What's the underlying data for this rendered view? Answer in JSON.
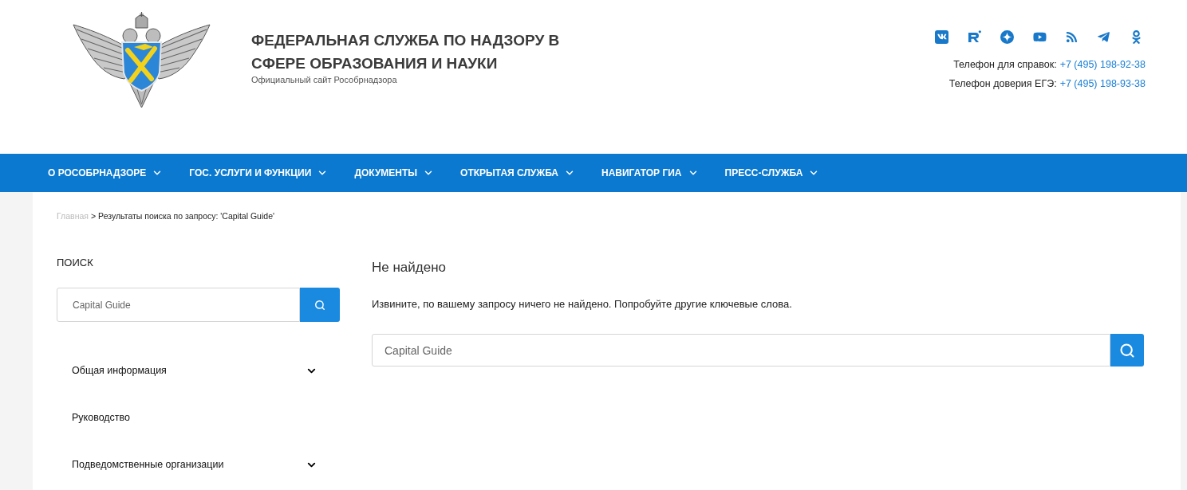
{
  "header": {
    "title": "ФЕДЕРАЛЬНАЯ СЛУЖБА ПО НАДЗОРУ В СФЕРЕ ОБРАЗОВАНИЯ И НАУКИ",
    "subtitle": "Официальный сайт Рособрнадзора",
    "social_links": [
      {
        "kind": "vk"
      },
      {
        "kind": "rutube"
      },
      {
        "kind": "dzen"
      },
      {
        "kind": "youtube"
      },
      {
        "kind": "rss"
      },
      {
        "kind": "telegram"
      },
      {
        "kind": "ok"
      }
    ],
    "contacts": [
      {
        "label": "Телефон для справок:",
        "phone": "+7 (495) 198-92-38"
      },
      {
        "label": "Телефон доверия ЕГЭ:",
        "phone": "+7 (495) 198-93-38"
      }
    ]
  },
  "nav": [
    {
      "label": "О РОСОБРНАДЗОРЕ",
      "has_dropdown": true
    },
    {
      "label": "ГОС. УСЛУГИ И ФУНКЦИИ",
      "has_dropdown": true
    },
    {
      "label": "ДОКУМЕНТЫ",
      "has_dropdown": true
    },
    {
      "label": "ОТКРЫТАЯ СЛУЖБА",
      "has_dropdown": true
    },
    {
      "label": "НАВИГАТОР ГИА",
      "has_dropdown": true
    },
    {
      "label": "ПРЕСС-СЛУЖБА",
      "has_dropdown": true
    }
  ],
  "breadcrumb": {
    "links": [
      "Главная"
    ],
    "separator": ">",
    "current": "Результаты поиска по запросу: 'Capital Guide'"
  },
  "sidebar": {
    "heading": "ПОИСК",
    "search": {
      "value": "Capital Guide"
    },
    "menu": [
      {
        "label": "Общая информация",
        "expandable": true
      },
      {
        "label": "Руководство",
        "expandable": false
      },
      {
        "label": "Подведомственные организации",
        "expandable": true
      }
    ]
  },
  "results": {
    "heading": "Не найдено",
    "message": "Извините, по вашему запросу ничего не найдено. Попробуйте другие ключевые слова.",
    "search": {
      "value": "Capital Guide"
    }
  }
}
